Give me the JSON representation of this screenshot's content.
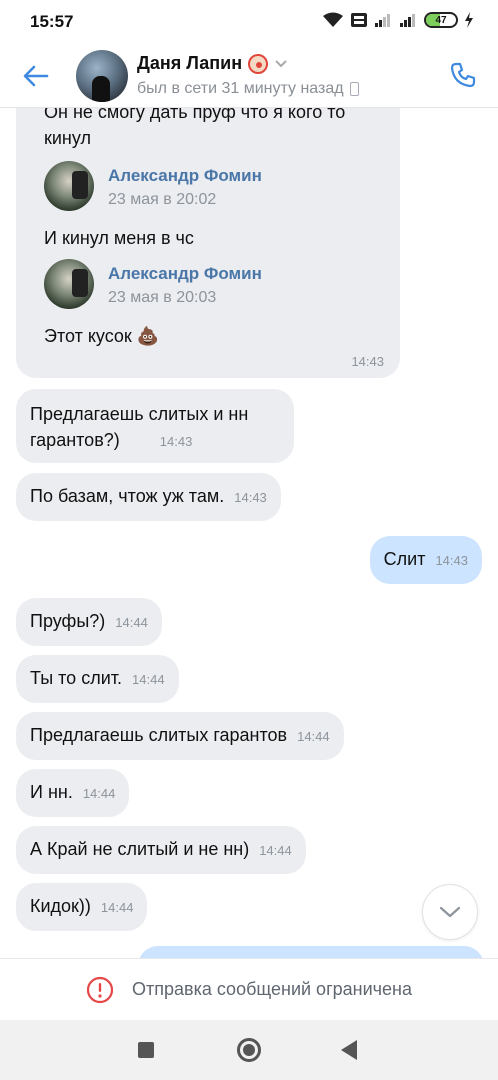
{
  "status_bar": {
    "time": "15:57",
    "battery": "47"
  },
  "header": {
    "contact_name": "Даня Лапин",
    "last_seen": "был в сети 31 минуту назад",
    "accent_color": "#4a76a8"
  },
  "forwarded_block": {
    "line1": "Он не смогу дать пруф что я кого то",
    "line2": "кинул",
    "messages": [
      {
        "author": "Александр Фомин",
        "date": "23 мая в 20:02",
        "text": "И кинул меня в чс"
      },
      {
        "author": "Александр Фомин",
        "date": "23 мая в 20:03",
        "text": "Этот кусок 💩"
      }
    ],
    "time": "14:43"
  },
  "messages": [
    {
      "side": "in",
      "lines": [
        "Предлагаешь слитых и нн",
        "гарантов?)"
      ],
      "time": "14:43"
    },
    {
      "side": "in",
      "lines": [
        "По базам, чтож уж там."
      ],
      "time": "14:43"
    },
    {
      "side": "out",
      "lines": [
        "Слит"
      ],
      "time": "14:43"
    },
    {
      "side": "in",
      "lines": [
        "Пруфы?)"
      ],
      "time": "14:44"
    },
    {
      "side": "in",
      "lines": [
        "Ты то слит."
      ],
      "time": "14:44"
    },
    {
      "side": "in",
      "lines": [
        "Предлагаешь слитых гарантов"
      ],
      "time": "14:44"
    },
    {
      "side": "in",
      "lines": [
        "И нн."
      ],
      "time": "14:44"
    },
    {
      "side": "in",
      "lines": [
        "А Край не слитый и не нн)"
      ],
      "time": "14:44"
    },
    {
      "side": "in",
      "lines": [
        "Кидок))"
      ],
      "time": "14:44"
    }
  ],
  "restriction": {
    "text": "Отправка сообщений ограничена",
    "icon": "warning-circle-icon",
    "color": "#e64646"
  }
}
